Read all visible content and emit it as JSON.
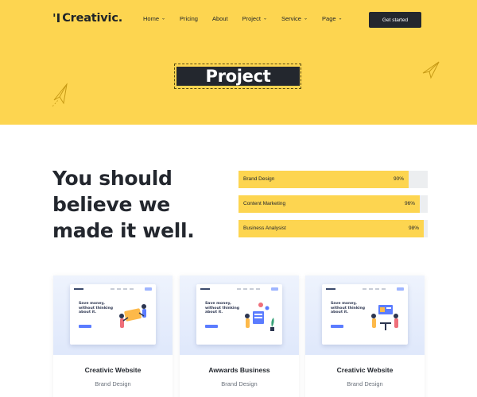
{
  "header": {
    "logo_mark": "'I",
    "logo": "Creativic.",
    "nav": [
      {
        "label": "Home",
        "dropdown": true
      },
      {
        "label": "Pricing",
        "dropdown": false
      },
      {
        "label": "About",
        "dropdown": false
      },
      {
        "label": "Project",
        "dropdown": true
      },
      {
        "label": "Service",
        "dropdown": true
      },
      {
        "label": "Page",
        "dropdown": true
      }
    ],
    "cta": "Get started"
  },
  "hero": {
    "title": "Project",
    "background_color": "#fdd550"
  },
  "intro": {
    "headline_lines": [
      "You should",
      "believe we",
      "made it well."
    ]
  },
  "skills": [
    {
      "label": "Brand Design",
      "value": "90%",
      "percent": 90
    },
    {
      "label": "Content Marketing",
      "value": "96%",
      "percent": 96
    },
    {
      "label": "Business Analysist",
      "value": "98%",
      "percent": 98
    }
  ],
  "projects": [
    {
      "title": "Creativic Website",
      "category": "Brand Design",
      "thumb_logo": "Creativic",
      "thumb_headline": [
        "Save money,",
        "without thinking",
        "about it."
      ]
    },
    {
      "title": "Awwards Business",
      "category": "Brand Design",
      "thumb_logo": "Creativic",
      "thumb_headline": [
        "Save money,",
        "without thinking",
        "about it."
      ]
    },
    {
      "title": "Creativic Website",
      "category": "Brand Design",
      "thumb_logo": "Creativic",
      "thumb_headline": [
        "Save money,",
        "without thinking",
        "about it."
      ]
    }
  ],
  "colors": {
    "accent": "#fdd550",
    "dark": "#23272e",
    "bar_track": "#eceef0",
    "mock_button": "#5b7cff"
  },
  "icons": {
    "hero_left": "paper-plane-icon",
    "hero_right": "paper-plane-icon",
    "nav_dropdown": "chevron-down-icon"
  }
}
